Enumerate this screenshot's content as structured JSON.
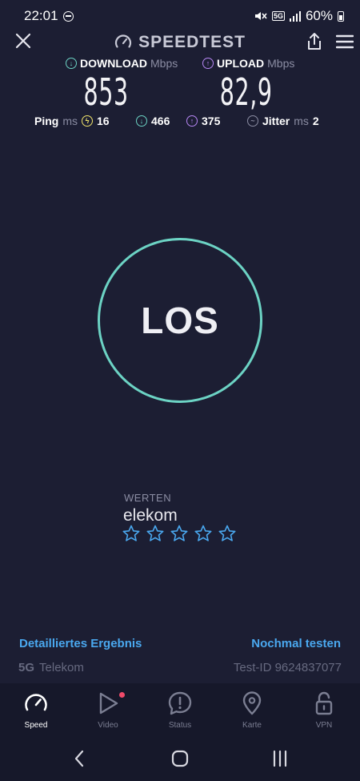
{
  "status_bar": {
    "time": "22:01",
    "network": "5G",
    "battery": "60%"
  },
  "header": {
    "brand": "SPEEDTEST"
  },
  "download": {
    "label": "DOWNLOAD",
    "unit": "Mbps",
    "value": "853"
  },
  "upload": {
    "label": "UPLOAD",
    "unit": "Mbps",
    "value": "82,9"
  },
  "stats": {
    "ping_label": "Ping",
    "ping_unit": "ms",
    "ping_value": "16",
    "down_latency": "466",
    "up_latency": "375",
    "jitter_label": "Jitter",
    "jitter_unit": "ms",
    "jitter_value": "2"
  },
  "go_button": {
    "label": "LOS"
  },
  "rating": {
    "label": "WERTEN",
    "isp": "elekom",
    "stars_total": 5,
    "stars_filled": 0,
    "star_color": "#4aa8ef"
  },
  "links": {
    "detailed": "Detailliertes Ergebnis",
    "retest": "Nochmal testen"
  },
  "connection": {
    "generation": "5G",
    "carrier": "Telekom",
    "test_id": "Test-ID 9624837077"
  },
  "nav": {
    "items": [
      {
        "label": "Speed",
        "icon": "speedometer-icon",
        "active": true
      },
      {
        "label": "Video",
        "icon": "play-icon",
        "active": false,
        "badge": true
      },
      {
        "label": "Status",
        "icon": "alert-icon",
        "active": false
      },
      {
        "label": "Karte",
        "icon": "map-pin-icon",
        "active": false
      },
      {
        "label": "VPN",
        "icon": "unlock-icon",
        "active": false
      }
    ]
  },
  "colors": {
    "background": "#1c1e33",
    "accent_ring": "#6cd3c4",
    "link": "#4aa8ef",
    "download": "#6cd3c4",
    "upload": "#b787f5",
    "ping": "#f1e46b"
  }
}
